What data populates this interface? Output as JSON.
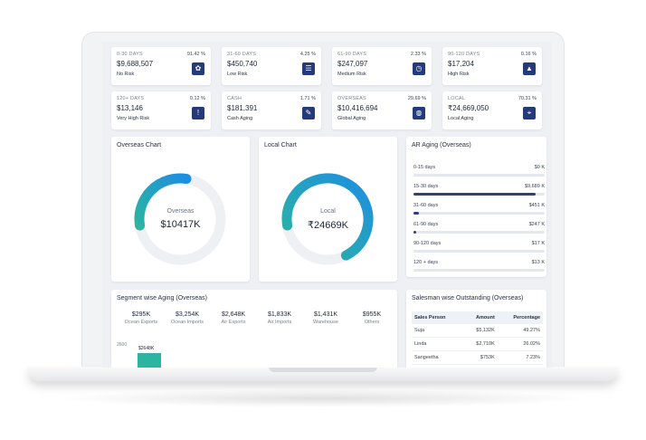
{
  "stats": [
    {
      "label": "0-30 DAYS",
      "pct": "91.42 %",
      "value": "$9,688,507",
      "risk": "No Risk",
      "icon": "safe-icon",
      "glyph": "✿"
    },
    {
      "label": "31-60 DAYS",
      "pct": "4.25 %",
      "value": "$450,740",
      "risk": "Low Risk",
      "icon": "document-icon",
      "glyph": "☰"
    },
    {
      "label": "61-90 DAYS",
      "pct": "2.33 %",
      "value": "$247,097",
      "risk": "Medium Risk",
      "icon": "clock-icon",
      "glyph": "◷"
    },
    {
      "label": "90-120 DAYS",
      "pct": "0.16 %",
      "value": "$17,204",
      "risk": "High Risk",
      "icon": "warning-icon",
      "glyph": "▲"
    },
    {
      "label": "120+ DAYS",
      "pct": "0.12 %",
      "value": "$13,146",
      "risk": "Very High Risk",
      "icon": "alert-icon",
      "glyph": "!"
    },
    {
      "label": "CASH",
      "pct": "1.71 %",
      "value": "$181,391",
      "risk": "Cash Aging",
      "icon": "cash-icon",
      "glyph": "✎"
    },
    {
      "label": "OVERSEAS",
      "pct": "29.69 %",
      "value": "$10,416,694",
      "risk": "Global Aging",
      "icon": "globe-icon",
      "glyph": "◍"
    },
    {
      "label": "LOCAL",
      "pct": "70.31 %",
      "value": "₹24,669,050",
      "risk": "Local Aging",
      "icon": "location-icon",
      "glyph": "⌖"
    }
  ],
  "overseas_chart": {
    "title": "Overseas Chart",
    "label": "Overseas",
    "value": "$10417K",
    "fraction": 0.3,
    "color_start": "#2bb5a0",
    "color_end": "#1e8fe0"
  },
  "local_chart": {
    "title": "Local Chart",
    "label": "Local",
    "value": "₹24669K",
    "fraction": 0.7,
    "color_start": "#2bb5a0",
    "color_end": "#1e8fe0"
  },
  "ar_aging": {
    "title": "AR Aging (Overseas)",
    "rows": [
      {
        "name": "0-15 days",
        "amount": "$0 K",
        "fraction": 0.0
      },
      {
        "name": "15-30 days",
        "amount": "$9,689 K",
        "fraction": 0.93
      },
      {
        "name": "31-60 days",
        "amount": "$451 K",
        "fraction": 0.04
      },
      {
        "name": "61-90 days",
        "amount": "$247 K",
        "fraction": 0.02
      },
      {
        "name": "90-120 days",
        "amount": "$17 K",
        "fraction": 0.0
      },
      {
        "name": "120 + days",
        "amount": "$13 K",
        "fraction": 0.0
      }
    ]
  },
  "segment": {
    "title": "Segment wise Aging (Overseas)",
    "cells": [
      {
        "value": "$295K",
        "name": "Ocean Exports"
      },
      {
        "value": "$3,254K",
        "name": "Ocean Imports"
      },
      {
        "value": "$2,648K",
        "name": "Air Exports"
      },
      {
        "value": "$1,833K",
        "name": "Air Imports"
      },
      {
        "value": "$1,431K",
        "name": "Warehouse"
      },
      {
        "value": "$955K",
        "name": "Others"
      }
    ],
    "axis_label": "2600",
    "bar_label": "$2648K",
    "bar_color": "#2bb5a0"
  },
  "salesman": {
    "title": "Salesman wise Outstanding (Overseas)",
    "headers": [
      "Sales Person",
      "Amount",
      "Percentage"
    ],
    "rows": [
      {
        "name": "Suja",
        "amount": "$5,132K",
        "pct": "49.27%"
      },
      {
        "name": "Linda",
        "amount": "$2,710K",
        "pct": "26.02%"
      },
      {
        "name": "Sangeetha",
        "amount": "$753K",
        "pct": "7.23%"
      }
    ]
  }
}
